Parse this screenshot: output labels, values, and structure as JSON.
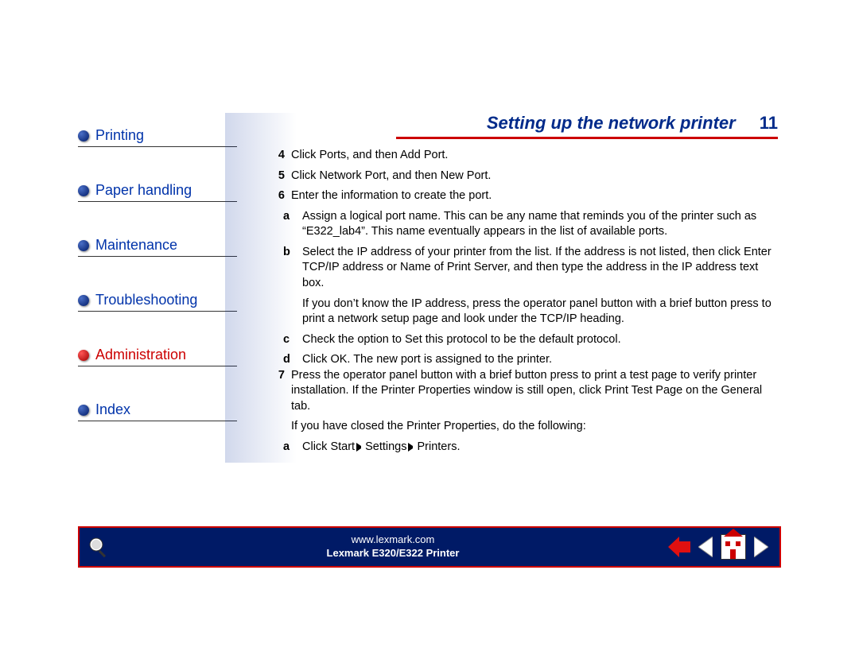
{
  "header": {
    "title": "Setting up the network printer",
    "page_number": "11"
  },
  "sidebar": {
    "items": [
      {
        "label": "Printing",
        "color": "blue",
        "active": false
      },
      {
        "label": "Paper handling",
        "color": "blue",
        "active": false
      },
      {
        "label": "Maintenance",
        "color": "blue",
        "active": false
      },
      {
        "label": "Troubleshooting",
        "color": "blue",
        "active": false
      },
      {
        "label": "Administration",
        "color": "red",
        "active": true
      },
      {
        "label": "Index",
        "color": "blue",
        "active": false
      }
    ]
  },
  "content": {
    "steps": {
      "4": "Click Ports, and then Add Port.",
      "5": "Click Network Port, and then New Port.",
      "6": "Enter the information to create the port.",
      "6a": "Assign a logical port name. This can be any name that reminds you of the printer such as “E322_lab4”. This name eventually appears in the list of available ports.",
      "6b": "Select the IP address of your printer from the list. If the address is not listed, then click Enter TCP/IP address or Name of Print Server, and then type the address in the IP address text box.",
      "6b_extra": "If you don’t know the IP address, press the operator panel button with a brief button press to print a network setup page and look under the TCP/IP heading.",
      "6c": "Check the option to Set this protocol to be the default protocol.",
      "6d": "Click OK. The new port is assigned to the printer.",
      "7": "Press the operator panel button with a brief button press to print a test page to verify printer installation. If the Printer Properties window is still open, click Print Test Page on the General tab.",
      "7_extra": "If you have closed the Printer Properties, do the following:",
      "7a_prefix": "Click Start",
      "7a_mid": "Settings",
      "7a_end": "Printers."
    }
  },
  "footer": {
    "url": "www.lexmark.com",
    "product": "Lexmark E320/E322 Printer"
  }
}
